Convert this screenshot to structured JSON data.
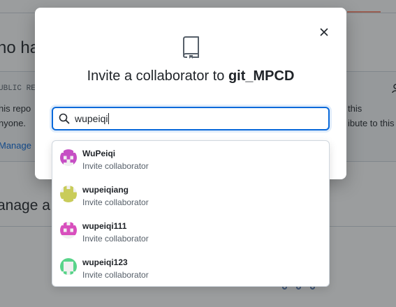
{
  "background": {
    "heading_partial": "ho ha",
    "visibility_label": "UBLIC RE",
    "line1_left": "his repo",
    "line2_left": "nyone.",
    "manage_link": "Manage",
    "line1_right": "this",
    "line2_right": "ibute to this",
    "section_heading": "anage a"
  },
  "dialog": {
    "title_prefix": "Invite a collaborator to ",
    "repo_name": "git_MPCD",
    "close_icon": "x-icon",
    "repo_icon": "repo-icon"
  },
  "search": {
    "value": "wupeiqi",
    "icon": "search-icon"
  },
  "suggestions": [
    {
      "username": "WuPeiqi",
      "action": "Invite collaborator",
      "avatar_color": "#c64fc4"
    },
    {
      "username": "wupeiqiang",
      "action": "Invite collaborator",
      "avatar_color": "#c9cc5a"
    },
    {
      "username": "wupeiqi111",
      "action": "Invite collaborator",
      "avatar_color": "#d84fbd"
    },
    {
      "username": "wupeiqi123",
      "action": "Invite collaborator",
      "avatar_color": "#59d48a"
    }
  ]
}
